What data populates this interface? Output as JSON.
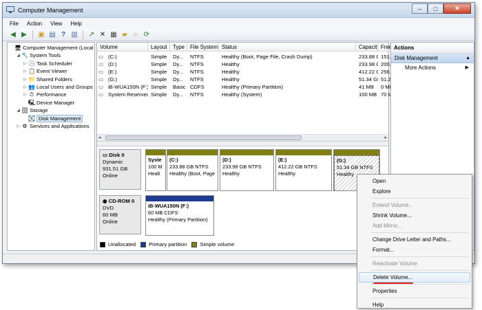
{
  "window": {
    "title": "Computer Management",
    "controls": {
      "minimize": "–",
      "maximize": "□",
      "close": "✕"
    }
  },
  "menu": [
    "File",
    "Action",
    "View",
    "Help"
  ],
  "toolbar": [
    "back-arrow-icon",
    "forward-arrow-icon",
    "up-folder-icon",
    "console-tree-icon",
    "help-icon",
    "properties-icon",
    "export-icon",
    "delete-icon",
    "properties-sheet-icon",
    "open-folder-icon",
    "search-icon",
    "refresh-icon"
  ],
  "tree": [
    {
      "label": "Computer Management (Local",
      "level": 0,
      "expander": "",
      "icon": "🖥"
    },
    {
      "label": "System Tools",
      "level": 1,
      "expander": "◢",
      "icon": "🔧"
    },
    {
      "label": "Task Scheduler",
      "level": 2,
      "expander": "▷",
      "icon": "🕒"
    },
    {
      "label": "Event Viewer",
      "level": 2,
      "expander": "▷",
      "icon": "📋"
    },
    {
      "label": "Shared Folders",
      "level": 2,
      "expander": "▷",
      "icon": "📁"
    },
    {
      "label": "Local Users and Groups",
      "level": 2,
      "expander": "▷",
      "icon": "👥"
    },
    {
      "label": "Performance",
      "level": 2,
      "expander": "▷",
      "icon": "⏱"
    },
    {
      "label": "Device Manager",
      "level": 2,
      "expander": "",
      "icon": "🖳"
    },
    {
      "label": "Storage",
      "level": 1,
      "expander": "◢",
      "icon": "🗄"
    },
    {
      "label": "Disk Management",
      "level": 2,
      "expander": "",
      "icon": "💽",
      "selected": true
    },
    {
      "label": "Services and Applications",
      "level": 1,
      "expander": "▷",
      "icon": "⚙"
    }
  ],
  "volume_list": {
    "columns": [
      "Volume",
      "Layout",
      "Type",
      "File System",
      "Status",
      "Capacity",
      "Free Sp"
    ],
    "rows": [
      [
        "(C:)",
        "Simple",
        "Dy...",
        "NTFS",
        "Healthy (Boot, Page File, Crash Dump)",
        "233.88 GB",
        "151.18"
      ],
      [
        "(D:)",
        "Simple",
        "Dy...",
        "NTFS",
        "Healthy",
        "233.98 GB",
        "200.02"
      ],
      [
        "(E:)",
        "Simple",
        "Dy...",
        "NTFS",
        "Healthy",
        "412.22 GB",
        "256.14"
      ],
      [
        "(G:)",
        "Simple",
        "Dy...",
        "NTFS",
        "Healthy",
        "51.34 GB",
        "51.22 G"
      ],
      [
        "iB-WUA150N (F:)",
        "Simple",
        "Basic",
        "CDFS",
        "Healthy (Primary Partition)",
        "41 MB",
        "0 MB"
      ],
      [
        "System Reserved",
        "Simple",
        "Dy...",
        "NTFS",
        "Healthy (System)",
        "100 MB",
        "70 MB"
      ]
    ]
  },
  "disks": [
    {
      "name": "Disk 0",
      "type": "Dynamic",
      "size": "931.51 GB",
      "status": "Online",
      "partitions": [
        {
          "name": "Syste",
          "size": "100 M",
          "status": "Healt",
          "kind": "simple"
        },
        {
          "name": "(C:)",
          "size": "233.88 GB NTFS",
          "status": "Healthy (Boot, Page",
          "kind": "simple"
        },
        {
          "name": "(D:)",
          "size": "233.98 GB NTFS",
          "status": "Healthy",
          "kind": "simple"
        },
        {
          "name": "(E:)",
          "size": "412.22 GB NTFS",
          "status": "Healthy",
          "kind": "simple"
        },
        {
          "name": "(G:)",
          "size": "51.34 GB NTFS",
          "status": "Healthy",
          "kind": "simple",
          "selected": true
        }
      ]
    },
    {
      "name": "CD-ROM 0",
      "type": "DVD",
      "size": "60 MB",
      "status": "Online",
      "partitions": [
        {
          "name": "iB-WUA150N  (F:)",
          "size": "60 MB CDFS",
          "status": "Healthy (Primary Partition)",
          "kind": "primary"
        }
      ]
    }
  ],
  "legend": [
    {
      "label": "Unallocated",
      "color": "#000000"
    },
    {
      "label": "Primary partition",
      "color": "#1c3a8e"
    },
    {
      "label": "Simple volume",
      "color": "#7f7f14"
    }
  ],
  "actions": {
    "header": "Actions",
    "section": "Disk Management",
    "more": "More Actions"
  },
  "context_menu": [
    {
      "label": "Open",
      "enabled": true
    },
    {
      "label": "Explore",
      "enabled": true
    },
    {
      "separator": true
    },
    {
      "label": "Extend Volume...",
      "enabled": false
    },
    {
      "label": "Shrink Volume...",
      "enabled": true
    },
    {
      "label": "Add Mirror...",
      "enabled": false
    },
    {
      "separator": true
    },
    {
      "label": "Change Drive Letter and Paths...",
      "enabled": true
    },
    {
      "label": "Format...",
      "enabled": true
    },
    {
      "separator": true
    },
    {
      "label": "Reactivate Volume",
      "enabled": false
    },
    {
      "separator": true
    },
    {
      "label": "Delete Volume...",
      "enabled": true,
      "highlighted": true
    },
    {
      "separator": true
    },
    {
      "label": "Properties",
      "enabled": true
    },
    {
      "separator": true
    },
    {
      "label": "Help",
      "enabled": true
    }
  ],
  "colors": {
    "accent": "#c0d5ee",
    "highlight_underline": "#e0201a"
  }
}
